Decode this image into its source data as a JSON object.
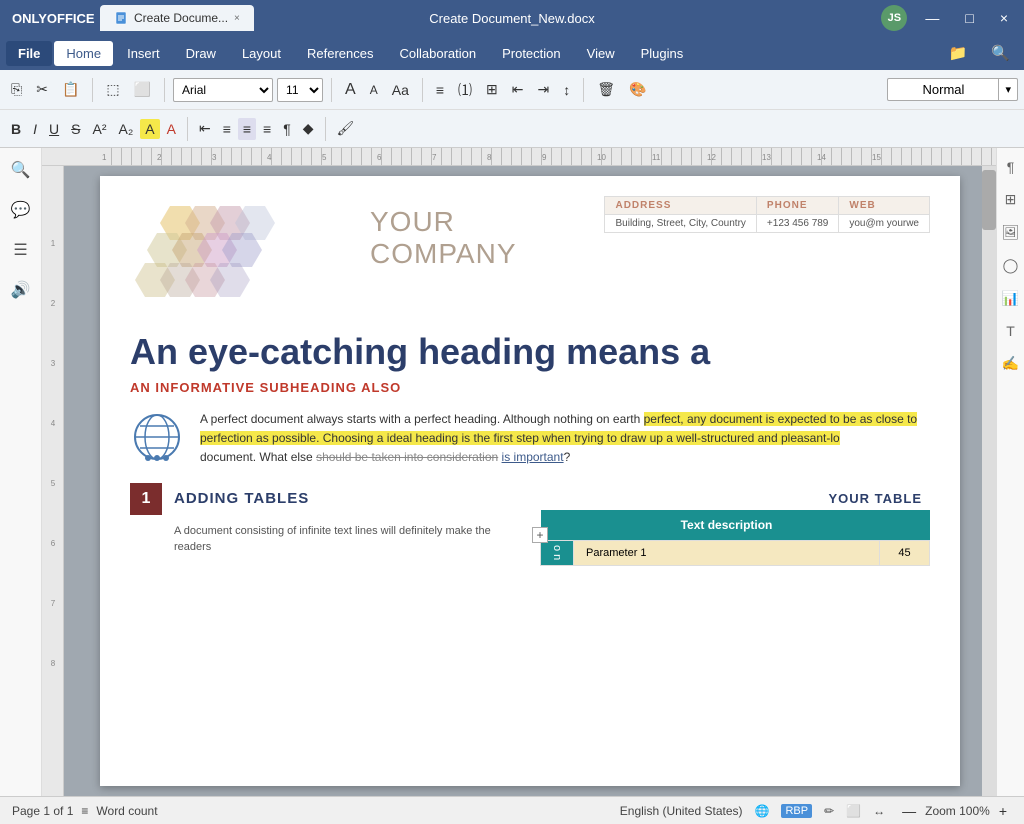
{
  "titlebar": {
    "app_name": "ONLYOFFICE",
    "tab_label": "Create Docume...",
    "doc_title": "Create Document_New.docx",
    "close_tab": "×",
    "minimize": "—",
    "maximize": "□",
    "close_win": "×",
    "user_initials": "JS"
  },
  "menubar": {
    "file": "File",
    "home": "Home",
    "insert": "Insert",
    "draw": "Draw",
    "layout": "Layout",
    "references": "References",
    "collaboration": "Collaboration",
    "protection": "Protection",
    "view": "View",
    "plugins": "Plugins"
  },
  "toolbar": {
    "font_family": "Arial",
    "font_size": "11",
    "style_label": "Normal",
    "style_arrow": "▾"
  },
  "document": {
    "company_name_line1": "YOUR",
    "company_name_line2": "COMPANY",
    "contact": {
      "address_header": "ADDRESS",
      "phone_header": "PHONE",
      "web_header": "WEB",
      "address_value": "Building, Street, City, Country",
      "phone_value": "+123 456 789",
      "web_value": "you@m yourwe"
    },
    "heading": "An eye-catching heading means a",
    "subheading": "AN INFORMATIVE SUBHEADING ALSO",
    "body_text": "A perfect document always starts with a perfect heading. Although nothing on earth perfect, any document is expected to be as close to perfection as possible. Choosing a ideal heading is the first step when trying to draw up a well-structured and pleasant-lo document. What else ",
    "body_strikethrough": "should be taken into consideration",
    "body_link": "is important",
    "body_end": "?",
    "section1": {
      "number": "1",
      "title": "ADDING TABLES",
      "description": "A document consisting of infinite text lines will definitely make the readers"
    },
    "table": {
      "title": "YOUR TABLE",
      "col1_header": "",
      "col2_header": "Text description",
      "col3_header": "",
      "row1_label": "o n",
      "row1_param": "Parameter 1",
      "row1_value": "45"
    }
  },
  "statusbar": {
    "page_info": "Page 1 of 1",
    "word_count_label": "Word count",
    "language": "English (United States)",
    "zoom_label": "Zoom 100%",
    "zoom_in": "+",
    "zoom_out": "—"
  },
  "icons": {
    "search": "🔍",
    "comment": "💬",
    "paragraph": "¶",
    "table": "⊞",
    "image": "🖼",
    "shape": "◯",
    "chart": "📊",
    "text": "T",
    "signature": "✍"
  }
}
